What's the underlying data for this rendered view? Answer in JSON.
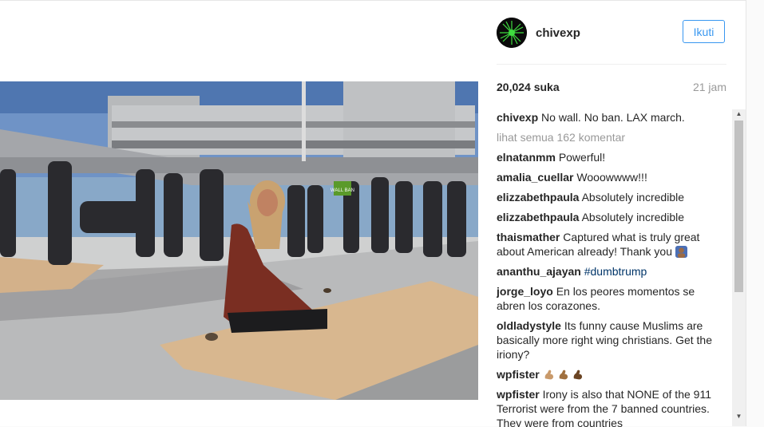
{
  "post": {
    "username": "chivexp",
    "follow_label": "Ikuti",
    "likes": "20,024 suka",
    "time": "21 jam",
    "view_all": "lihat semua 162 komentar",
    "photo_sign": "WALL BAN"
  },
  "comments": [
    {
      "user": "chivexp",
      "text": "No wall. No ban. LAX march."
    },
    {
      "user": "elnatanmm",
      "text": "Powerful!"
    },
    {
      "user": "amalia_cuellar",
      "text": "Wooowwww!!!"
    },
    {
      "user": "elizzabethpaula",
      "text": "Absolutely incredible"
    },
    {
      "user": "elizzabethpaula",
      "text": "Absolutely incredible"
    },
    {
      "user": "thaismather",
      "text": "Captured what is truly great about American already! Thank you"
    },
    {
      "user": "ananthu_ajayan",
      "tag": "#dumbtrump"
    },
    {
      "user": "jorge_loyo",
      "text": "En los peores momentos se abren los corazones."
    },
    {
      "user": "oldladystyle",
      "text": "Its funny cause Muslims are basically more right wing christians. Get the iriony?"
    },
    {
      "user": "wpfister",
      "text": ""
    },
    {
      "user": "wpfister",
      "text": "Irony is also that NONE of the 911 Terrorist were from the 7 banned countries. They were from countries"
    }
  ],
  "icons": {
    "avatar": "avatar-icon",
    "scroll_up": "▲",
    "scroll_down": "▼"
  },
  "colors": {
    "link_blue": "#3897f0",
    "muted": "#999999",
    "text": "#262626"
  }
}
